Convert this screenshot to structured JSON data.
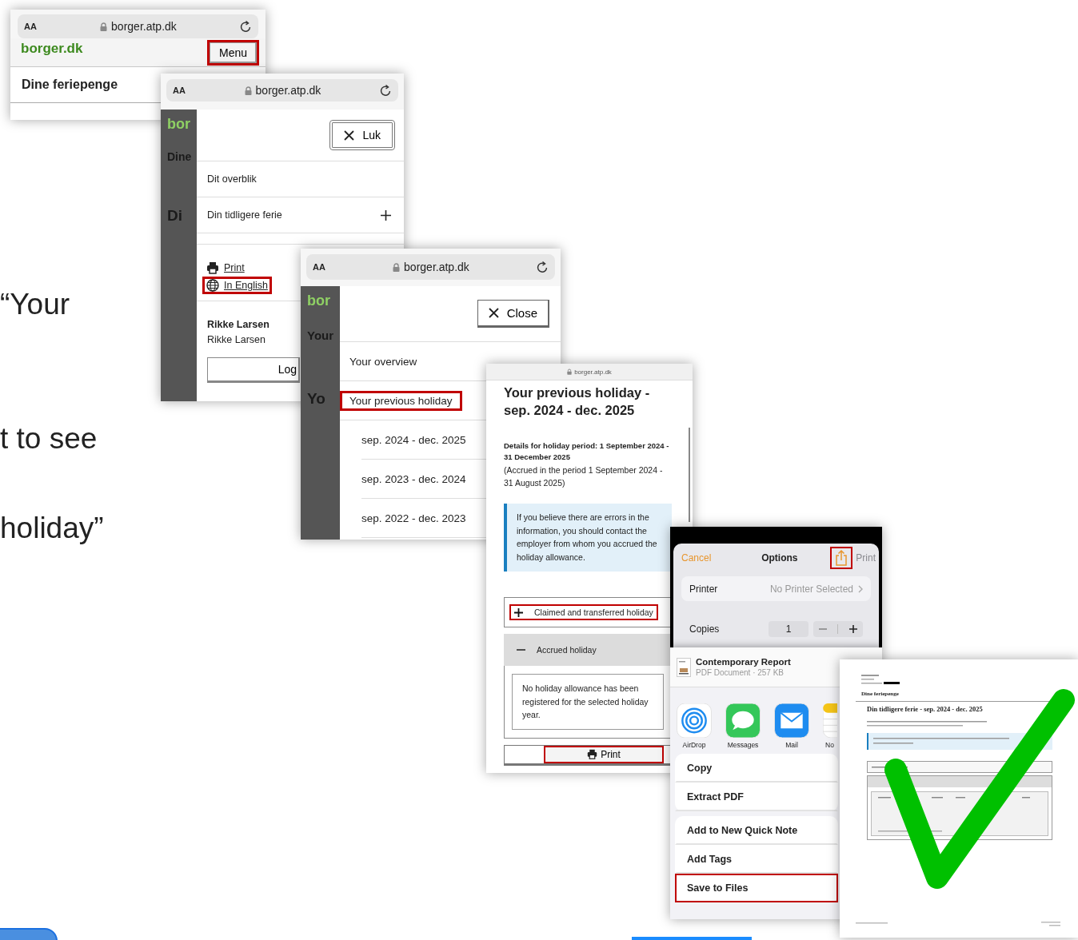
{
  "slide_text": [
    "“Your",
    "t to see",
    "holiday”"
  ],
  "start_screen": {
    "url_bar": {
      "aa": "AA",
      "url": "borger.atp.dk"
    },
    "logo": "borger.dk",
    "menu_button": {
      "label": "Menu",
      "highlighted": true
    },
    "heading": "Dine feriepenge"
  },
  "danish_menu": {
    "url_bar": {
      "aa": "AA",
      "url": "borger.atp.dk"
    },
    "background_texts": [
      "bor",
      "Dine",
      "Di"
    ],
    "close_button": "Luk",
    "items": [
      {
        "label": "Dit overblik",
        "expandable": false
      },
      {
        "label": "Din tidligere ferie",
        "expandable": true
      }
    ],
    "links": [
      {
        "kind": "print",
        "label": "Print",
        "highlighted": false
      },
      {
        "kind": "language",
        "label": "In English",
        "highlighted": true
      }
    ],
    "user": {
      "name": "Rikke Larsen",
      "subtitle": "Rikke Larsen"
    },
    "logout_button": "Log"
  },
  "english_menu": {
    "url_bar": {
      "aa": "AA",
      "url": "borger.atp.dk"
    },
    "background_texts": [
      "bor",
      "Your",
      "Yo"
    ],
    "close_button": "Close",
    "items": [
      {
        "label": "Your overview",
        "highlighted": false
      },
      {
        "label": "Your previous holiday",
        "highlighted": true
      }
    ],
    "sub_items": [
      "sep. 2024 - dec. 2025",
      "sep. 2023 - dec. 2024",
      "sep. 2022 - dec. 2023"
    ]
  },
  "holiday_page": {
    "url": "borger.atp.dk",
    "title": "Your previous holiday - sep. 2024 - dec. 2025",
    "details": "Details for holiday period: 1 September 2024 - 31 December 2025",
    "accrued_note": "(Accrued in the period 1 September 2024 - 31 August 2025)",
    "info": "If you believe there are errors in the information, you should contact the employer from whom you accrued the holiday allowance.",
    "accordions": [
      {
        "label": "Claimed and transferred holiday",
        "expanded": false,
        "highlighted": true
      },
      {
        "label": "Accrued holiday",
        "expanded": true,
        "highlighted": false,
        "message": "No holiday allowance has been registered for the selected holiday year."
      }
    ],
    "print_button": {
      "label": "Print",
      "highlighted": true
    }
  },
  "print_options": {
    "cancel": "Cancel",
    "title": "Options",
    "share_highlighted": true,
    "print": {
      "label": "Print",
      "disabled": true
    },
    "printer": {
      "label": "Printer",
      "value": "No Printer Selected"
    },
    "copies": {
      "label": "Copies",
      "value": "1"
    },
    "document": {
      "title": "Contemporary Report",
      "subtitle": "PDF Document · 257 KB"
    },
    "apps": [
      {
        "kind": "airdrop",
        "label": "AirDrop"
      },
      {
        "kind": "messages",
        "label": "Messages"
      },
      {
        "kind": "mail",
        "label": "Mail"
      },
      {
        "kind": "notes",
        "label": "No"
      }
    ],
    "action_groups": [
      {
        "items": [
          {
            "label": "Copy",
            "highlighted": false
          },
          {
            "label": "Extract PDF",
            "highlighted": false
          }
        ]
      },
      {
        "items": [
          {
            "label": "Add to New Quick Note",
            "highlighted": false
          },
          {
            "label": "Add Tags",
            "highlighted": false
          },
          {
            "label": "Save to Files",
            "highlighted": true
          }
        ]
      }
    ]
  },
  "pdf_preview": {
    "section": "Dine feriepenge",
    "heading": "Din tidligere ferie - sep. 2024 - dec. 2025"
  }
}
